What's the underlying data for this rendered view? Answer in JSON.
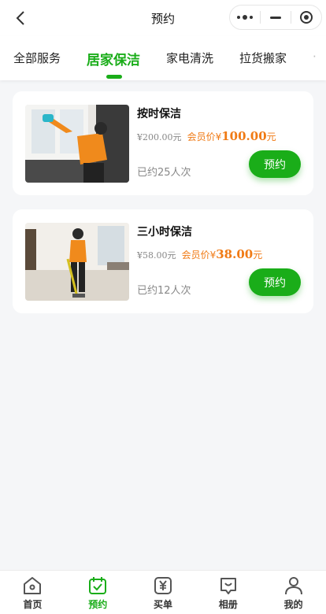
{
  "navbar": {
    "title": "预约",
    "back_icon": "chevron-left-icon",
    "capsule_icons": [
      "more-dots-icon",
      "minimize-icon",
      "target-icon"
    ]
  },
  "tabs": [
    {
      "label": "全部服务",
      "active": false
    },
    {
      "label": "居家保洁",
      "active": true
    },
    {
      "label": "家电清洗",
      "active": false
    },
    {
      "label": "拉货搬家",
      "active": false
    }
  ],
  "services": [
    {
      "title": "按时保洁",
      "original_price": "¥200.00元",
      "member_label": "会员价¥",
      "member_price": "100.00",
      "member_unit": "元",
      "booked": "已约25人次",
      "button": "预约"
    },
    {
      "title": "三小时保洁",
      "original_price": "¥58.00元",
      "member_label": "会员价¥",
      "member_price": "38.00",
      "member_unit": "元",
      "booked": "已约12人次",
      "button": "预约"
    }
  ],
  "tabbar": [
    {
      "label": "首页",
      "icon": "home-icon",
      "active": false
    },
    {
      "label": "预约",
      "icon": "calendar-check-icon",
      "active": true
    },
    {
      "label": "买单",
      "icon": "yen-icon",
      "active": false
    },
    {
      "label": "相册",
      "icon": "album-icon",
      "active": false
    },
    {
      "label": "我的",
      "icon": "user-icon",
      "active": false
    }
  ],
  "colors": {
    "accent": "#1aad19",
    "price": "#f07a14",
    "background": "#f5f6f8"
  }
}
